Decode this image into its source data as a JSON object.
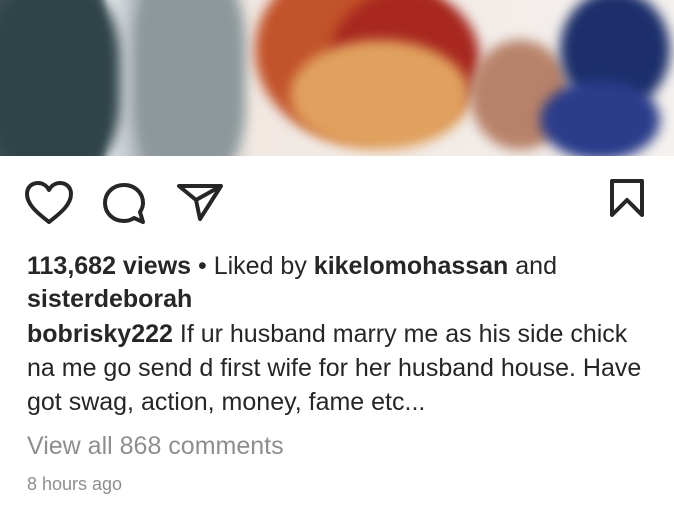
{
  "post": {
    "views": "113,682 views",
    "separator": "•",
    "liked_by_prefix": "Liked by",
    "liked_user_1": "kikelomohassan",
    "and_word": "and",
    "liked_user_2": "sisterdeborah",
    "caption_username": "bobrisky222",
    "caption_text": "If ur husband marry me as his side chick na me go send d first wife for her husband house. Have got swag, action,  money, fame etc...",
    "view_comments": "View all 868 comments",
    "timestamp": "8 hours ago"
  },
  "icons": {
    "like": "heart-icon",
    "comment": "comment-bubble-icon",
    "share": "send-paper-plane-icon",
    "save": "bookmark-icon"
  }
}
